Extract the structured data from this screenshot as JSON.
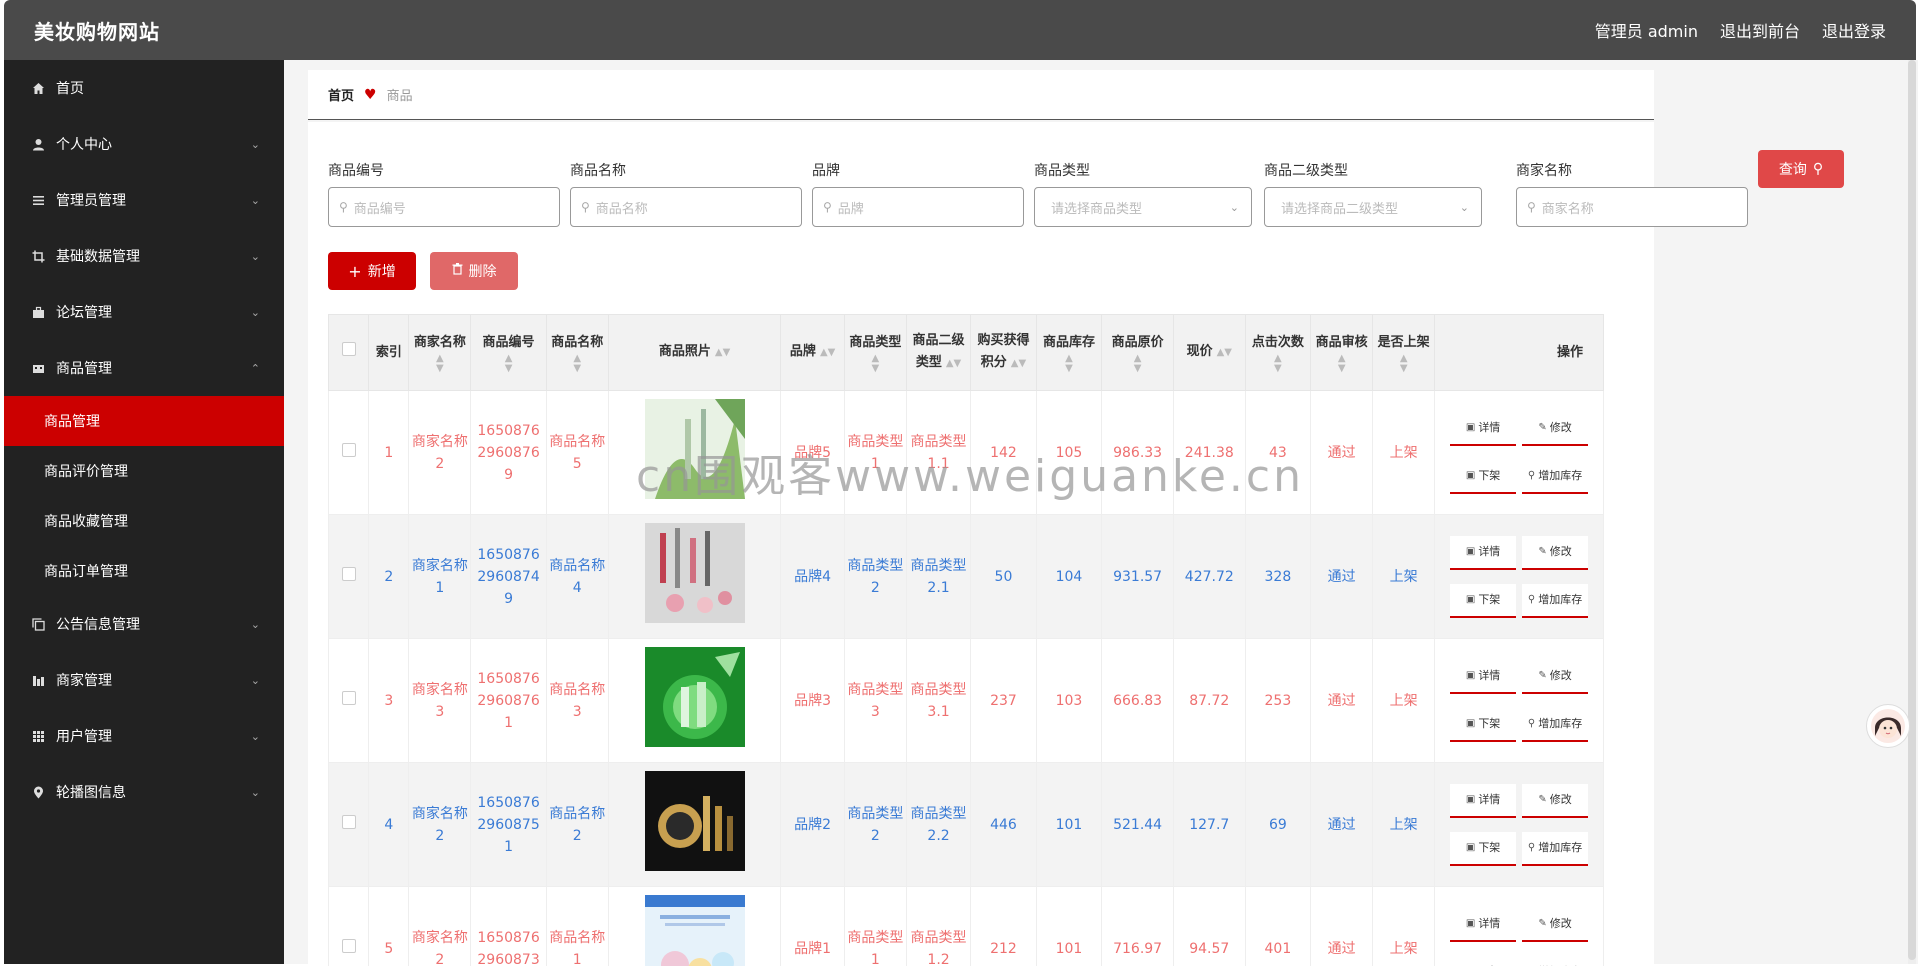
{
  "header": {
    "brand": "美妆购物网站",
    "admin": "管理员 admin",
    "to_front": "退出到前台",
    "logout": "退出登录"
  },
  "sidebar": {
    "items": [
      {
        "label": "首页",
        "icon": "home-icon"
      },
      {
        "label": "个人中心",
        "icon": "user-icon"
      },
      {
        "label": "管理员管理",
        "icon": "list-icon"
      },
      {
        "label": "基础数据管理",
        "icon": "crop-icon"
      },
      {
        "label": "论坛管理",
        "icon": "briefcase-icon"
      },
      {
        "label": "商品管理",
        "icon": "goods-icon"
      }
    ],
    "sub_items": [
      {
        "label": "商品管理"
      },
      {
        "label": "商品评价管理"
      },
      {
        "label": "商品收藏管理"
      },
      {
        "label": "商品订单管理"
      }
    ],
    "items_after": [
      {
        "label": "公告信息管理",
        "icon": "copy-icon"
      },
      {
        "label": "商家管理",
        "icon": "chart-icon"
      },
      {
        "label": "用户管理",
        "icon": "grid-icon"
      },
      {
        "label": "轮播图信息",
        "icon": "pin-icon"
      }
    ]
  },
  "breadcrumb": {
    "home": "首页",
    "current": "商品"
  },
  "search": {
    "code_label": "商品编号",
    "code_ph": "商品编号",
    "name_label": "商品名称",
    "name_ph": "商品名称",
    "brand_label": "品牌",
    "brand_ph": "品牌",
    "type_label": "商品类型",
    "type_ph": "请选择商品类型",
    "type2_label": "商品二级类型",
    "type2_ph": "请选择商品二级类型",
    "shop_label": "商家名称",
    "shop_ph": "商家名称",
    "query": "查询"
  },
  "actions": {
    "add": "新增",
    "delete": "删除"
  },
  "table": {
    "headers": {
      "index": "索引",
      "shop": "商家名称",
      "code": "商品编号",
      "name": "商品名称",
      "photo": "商品照片",
      "brand": "品牌",
      "type": "商品类型",
      "type2a": "商品二级",
      "type2b": "类型",
      "points_a": "购买获得",
      "points_b": "积分",
      "stock": "商品库存",
      "orig": "商品原价",
      "price": "现价",
      "clicks": "点击次数",
      "audit": "商品审核",
      "onsale": "是否上架",
      "ops": "操作"
    },
    "op_labels": {
      "detail": "详情",
      "edit": "修改",
      "offshelf": "下架",
      "addstock": "增加库存"
    },
    "rows": [
      {
        "index": "1",
        "shop_a": "商家名称",
        "shop_b": "2",
        "code_a": "1650876",
        "code_b": "2960876",
        "code_c": "9",
        "name_a": "商品名称",
        "name_b": "5",
        "brand": "品牌5",
        "type_a": "商品类型",
        "type_b": "1",
        "type2_a": "商品类型",
        "type2_b": "1.1",
        "points": "142",
        "stock": "105",
        "orig": "986.33",
        "price": "241.38",
        "clicks": "43",
        "audit": "通过",
        "onsale": "上架"
      },
      {
        "index": "2",
        "shop_a": "商家名称",
        "shop_b": "1",
        "code_a": "1650876",
        "code_b": "2960874",
        "code_c": "9",
        "name_a": "商品名称",
        "name_b": "4",
        "brand": "品牌4",
        "type_a": "商品类型",
        "type_b": "2",
        "type2_a": "商品类型",
        "type2_b": "2.1",
        "points": "50",
        "stock": "104",
        "orig": "931.57",
        "price": "427.72",
        "clicks": "328",
        "audit": "通过",
        "onsale": "上架"
      },
      {
        "index": "3",
        "shop_a": "商家名称",
        "shop_b": "3",
        "code_a": "1650876",
        "code_b": "2960876",
        "code_c": "1",
        "name_a": "商品名称",
        "name_b": "3",
        "brand": "品牌3",
        "type_a": "商品类型",
        "type_b": "3",
        "type2_a": "商品类型",
        "type2_b": "3.1",
        "points": "237",
        "stock": "103",
        "orig": "666.83",
        "price": "87.72",
        "clicks": "253",
        "audit": "通过",
        "onsale": "上架"
      },
      {
        "index": "4",
        "shop_a": "商家名称",
        "shop_b": "2",
        "code_a": "1650876",
        "code_b": "2960875",
        "code_c": "1",
        "name_a": "商品名称",
        "name_b": "2",
        "brand": "品牌2",
        "type_a": "商品类型",
        "type_b": "2",
        "type2_a": "商品类型",
        "type2_b": "2.2",
        "points": "446",
        "stock": "101",
        "orig": "521.44",
        "price": "127.7",
        "clicks": "69",
        "audit": "通过",
        "onsale": "上架"
      },
      {
        "index": "5",
        "shop_a": "商家名称",
        "shop_b": "2",
        "code_a": "1650876",
        "code_b": "2960873",
        "code_c": "",
        "name_a": "商品名称",
        "name_b": "1",
        "brand": "品牌1",
        "type_a": "商品类型",
        "type_b": "1",
        "type2_a": "商品类型",
        "type2_b": "1.2",
        "points": "212",
        "stock": "101",
        "orig": "716.97",
        "price": "94.57",
        "clicks": "401",
        "audit": "通过",
        "onsale": "上架"
      }
    ]
  },
  "watermark": "cn围观客www.weiguanke.cn",
  "colors": {
    "accent": "#cc0000",
    "odd_text": "#ee7070",
    "even_text": "#3a7bd5",
    "sidebar_bg": "#222222",
    "header_bg": "#4a4a4a"
  }
}
